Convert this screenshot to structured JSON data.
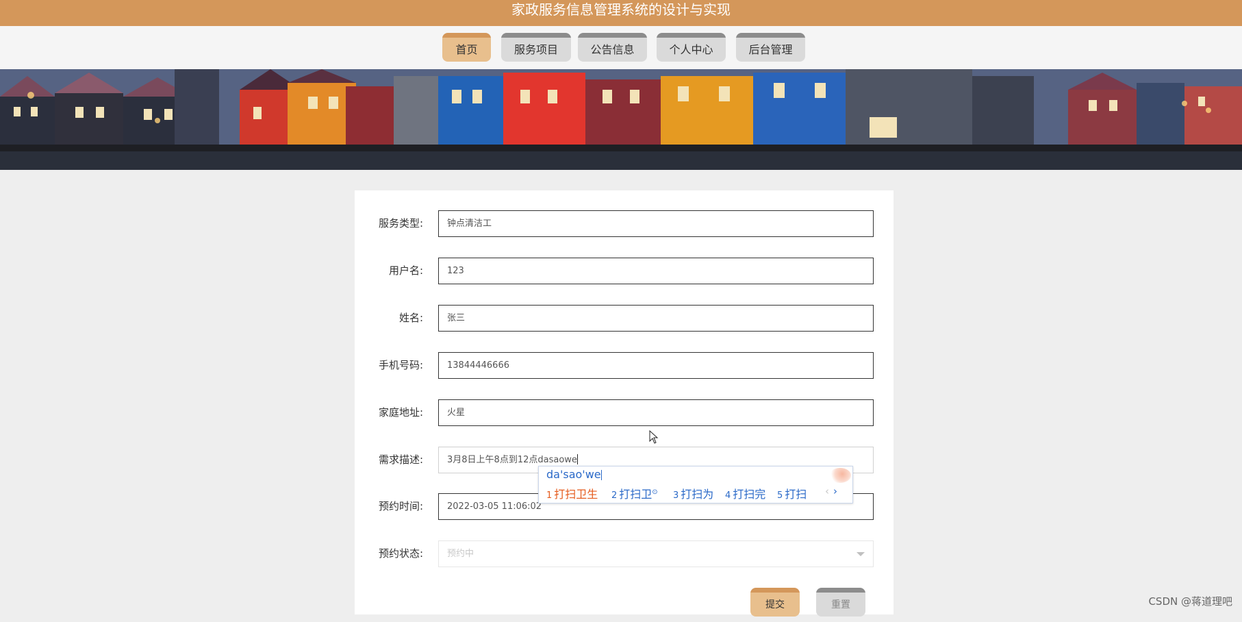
{
  "app": {
    "title": "家政服务信息管理系统的设计与实现"
  },
  "nav": {
    "items": [
      {
        "label": "首页",
        "active": true
      },
      {
        "label": "服务项目",
        "active": false
      },
      {
        "label": "公告信息",
        "active": false
      },
      {
        "label": "个人中心",
        "active": false
      },
      {
        "label": "后台管理",
        "active": false
      }
    ]
  },
  "form": {
    "fields": {
      "service_type": {
        "label": "服务类型:",
        "value": "钟点清洁工"
      },
      "username": {
        "label": "用户名:",
        "value": "123"
      },
      "name": {
        "label": "姓名:",
        "value": "张三"
      },
      "phone": {
        "label": "手机号码:",
        "value": "13844446666"
      },
      "address": {
        "label": "家庭地址:",
        "value": "火星"
      },
      "description": {
        "label": "需求描述:",
        "value": "3月8日上午8点到12点dasaowe"
      },
      "appointment_time": {
        "label": "预约时间:",
        "value": "2022-03-05 11:06:02"
      },
      "status": {
        "label": "预约状态:",
        "value": "预约中"
      }
    },
    "buttons": {
      "submit": "提交",
      "reset": "重置"
    }
  },
  "ime": {
    "composition": "da'sao'we",
    "candidates": [
      {
        "num": "1",
        "text": "打扫卫生"
      },
      {
        "num": "2",
        "text": "打扫卫"
      },
      {
        "num": "3",
        "text": "打扫为"
      },
      {
        "num": "4",
        "text": "打扫完"
      },
      {
        "num": "5",
        "text": "打扫"
      }
    ],
    "prev": "‹",
    "next": "›"
  },
  "watermark": "CSDN @蒋道理吧",
  "colors": {
    "brand": "#d4975a",
    "brand_light": "#e8bf8d",
    "ime_blue": "#2a69c8",
    "ime_orange": "#e55a1c"
  }
}
